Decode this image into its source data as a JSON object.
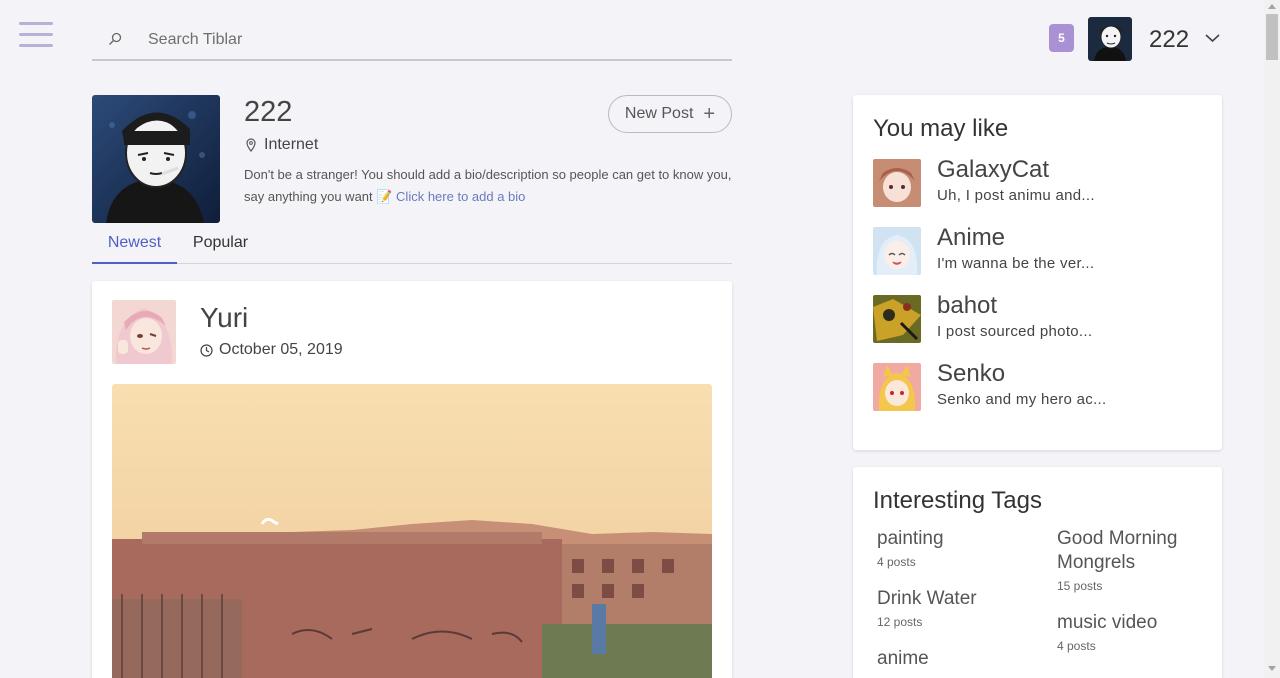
{
  "search": {
    "placeholder": "Search Tiblar"
  },
  "header": {
    "notification_count": "5",
    "username": "222"
  },
  "profile": {
    "name": "222",
    "location": "Internet",
    "bio": "Don't be a stranger! You should add a bio/description so people can get to know you, say anything you want 📝 ",
    "bio_link": "Click here to add a bio",
    "new_post_label": "New Post",
    "new_post_icon": "+"
  },
  "tabs": [
    {
      "label": "Newest",
      "active": true
    },
    {
      "label": "Popular",
      "active": false
    }
  ],
  "post": {
    "author": "Yuri",
    "date": "October 05, 2019"
  },
  "sidebar": {
    "may_like_title": "You may like",
    "suggestions": [
      {
        "name": "GalaxyCat",
        "desc": "Uh, I post animu and..."
      },
      {
        "name": "Anime",
        "desc": "I'm wanna be the ver..."
      },
      {
        "name": "bahot",
        "desc": "I post sourced photo..."
      },
      {
        "name": "Senko",
        "desc": "Senko and my hero ac..."
      }
    ],
    "tags_title": "Interesting Tags",
    "tags": [
      {
        "name": "painting",
        "count": "4 posts"
      },
      {
        "name": "Good Morning Mongrels",
        "count": "15 posts"
      },
      {
        "name": "Drink Water",
        "count": "12 posts"
      },
      {
        "name": "music video",
        "count": "4 posts"
      },
      {
        "name": "anime",
        "count": ""
      }
    ]
  },
  "colors": {
    "accent": "#4f5fc6",
    "badge": "#a991d4",
    "link": "#6b7bbd"
  }
}
